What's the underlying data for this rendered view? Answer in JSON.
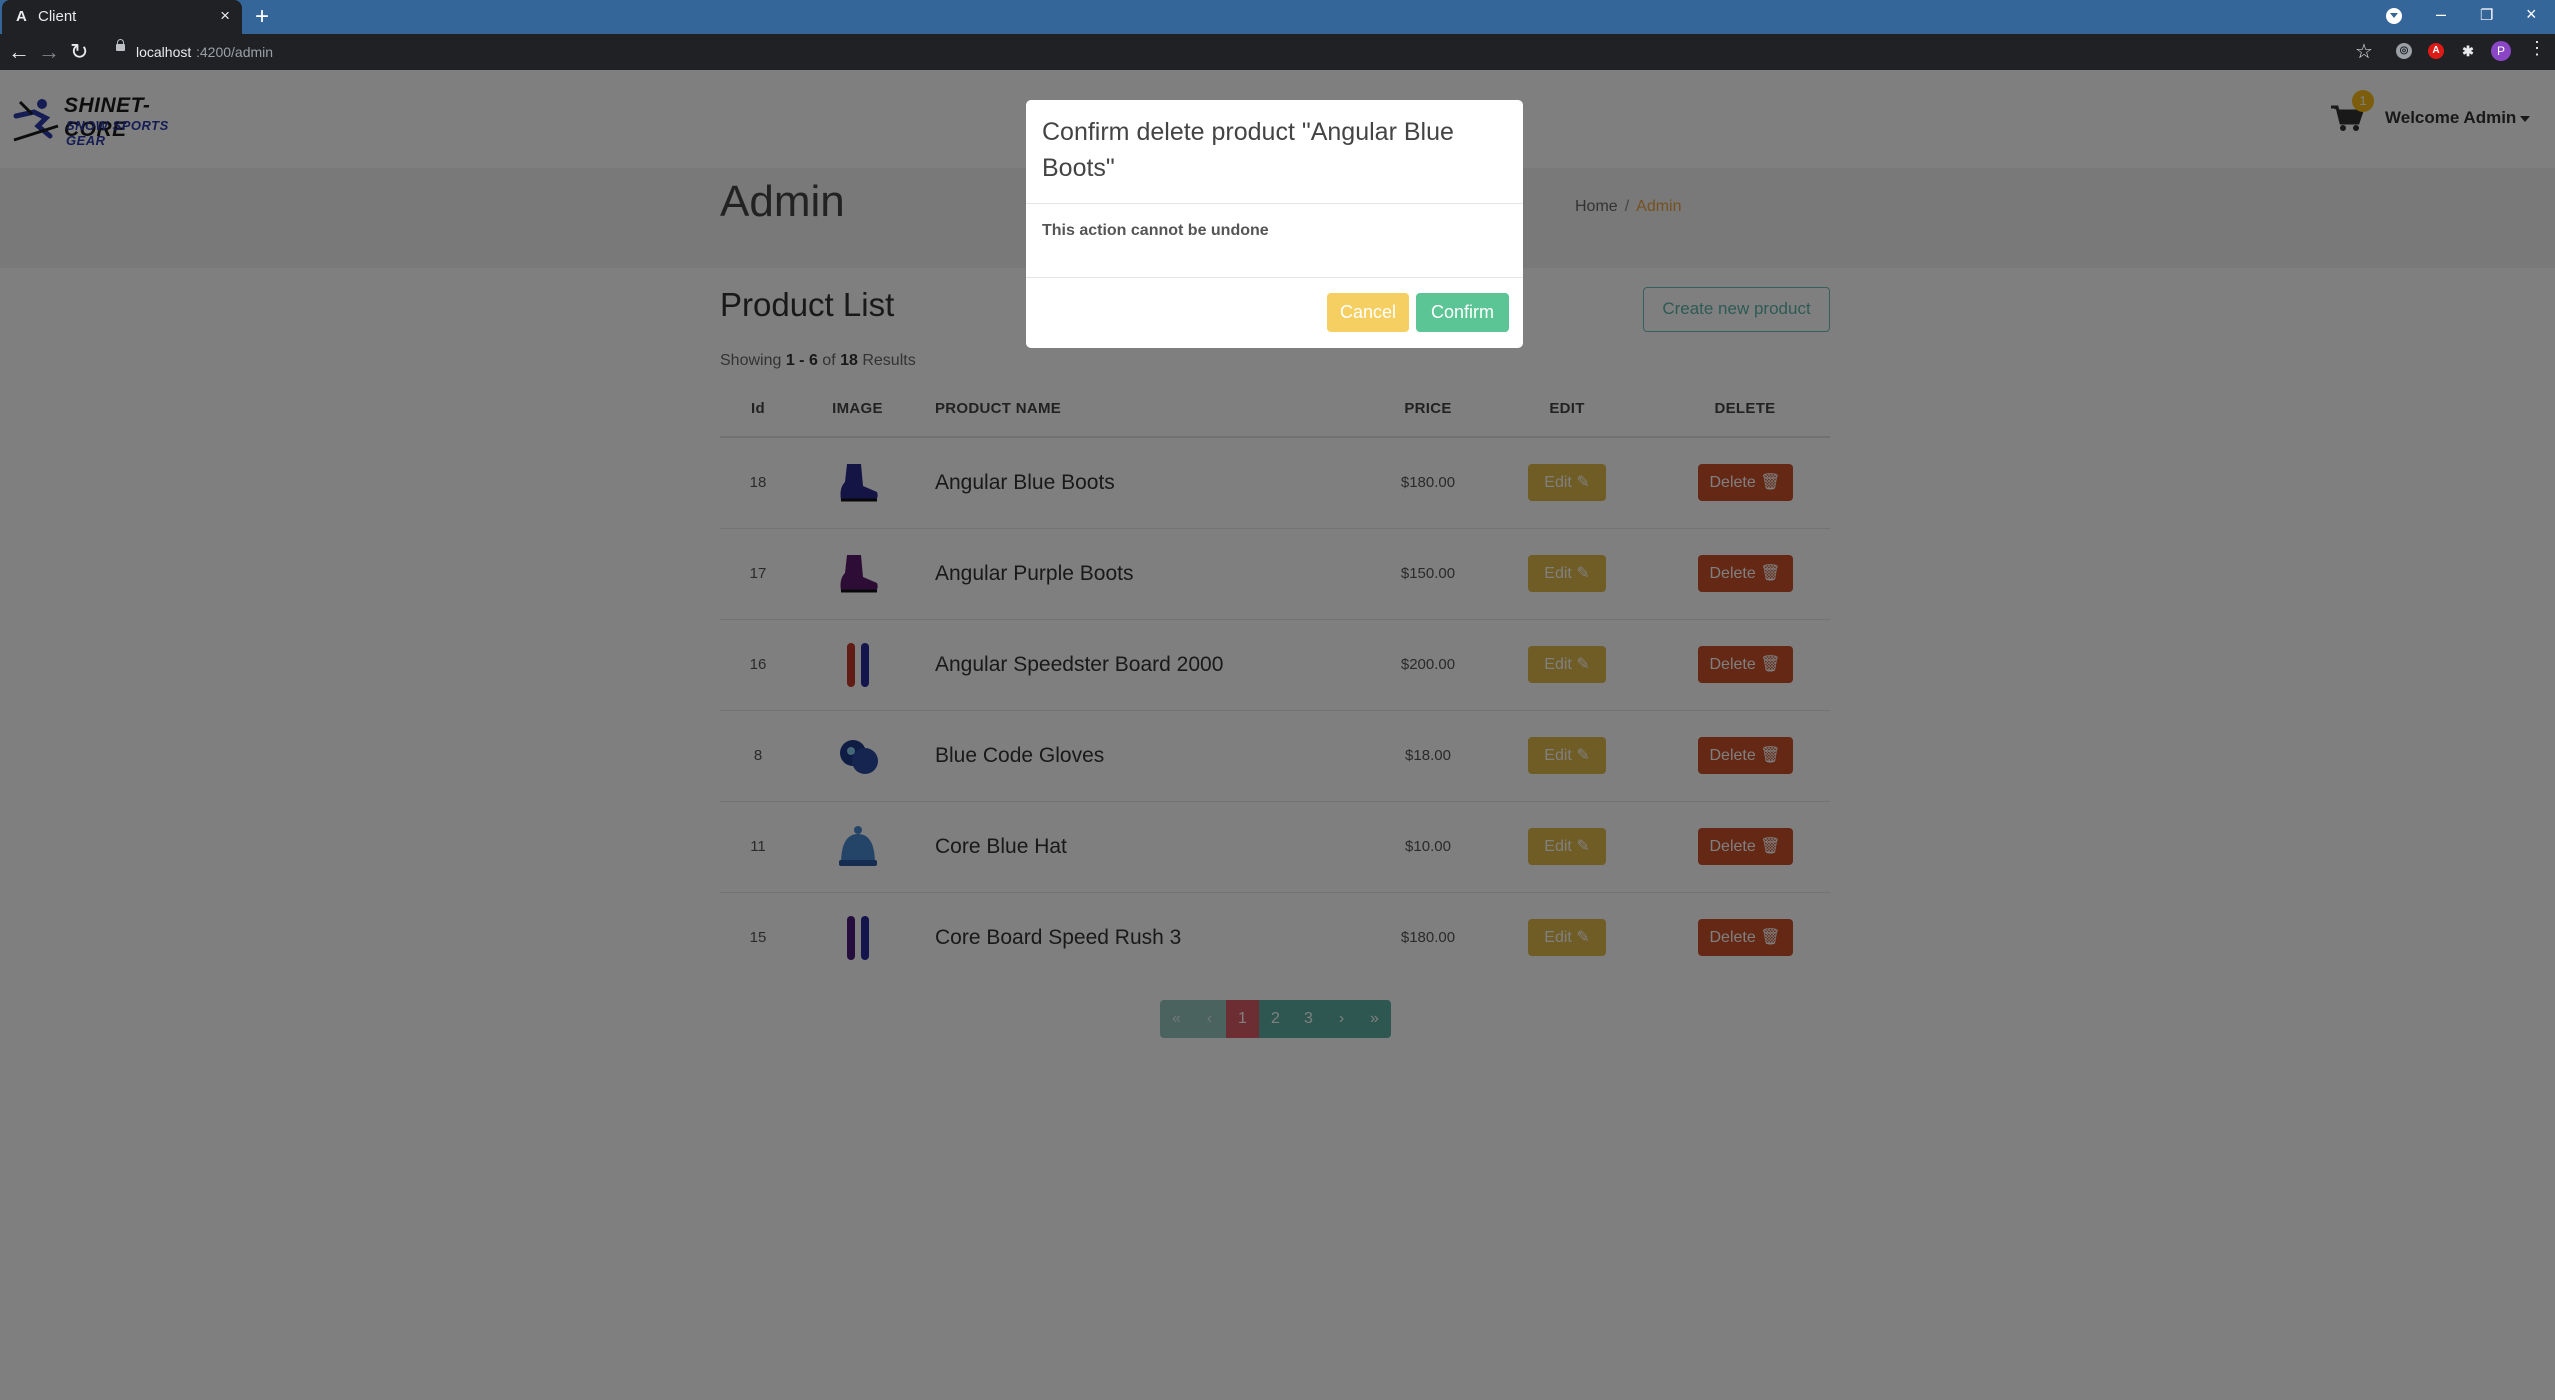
{
  "browser": {
    "tab_title": "Client",
    "tab_favicon": "A",
    "url_host": "localhost",
    "url_path": ":4200/admin",
    "profile_initial": "P"
  },
  "header": {
    "logo_line1": "SHINET-CORE",
    "logo_line2": "SNOW SPORTS GEAR",
    "cart_count": "1",
    "welcome": "Welcome Admin"
  },
  "hero": {
    "title": "Admin",
    "breadcrumb": {
      "home": "Home",
      "separator": "/",
      "current": "Admin"
    }
  },
  "product_list": {
    "title": "Product List",
    "create_button": "Create new product",
    "showing": {
      "prefix": "Showing",
      "range": "1 - 6",
      "of": "of",
      "total": "18",
      "suffix": "Results"
    },
    "columns": {
      "id": "Id",
      "image": "IMAGE",
      "name": "PRODUCT NAME",
      "price": "PRICE",
      "edit": "EDIT",
      "delete": "DELETE"
    },
    "edit_label": "Edit",
    "delete_label": "Delete",
    "rows": [
      {
        "id": "18",
        "name": "Angular Blue Boots",
        "price": "$180.00",
        "image": "boot-icon",
        "color": "#2a2a8a"
      },
      {
        "id": "17",
        "name": "Angular Purple Boots",
        "price": "$150.00",
        "image": "boot-icon",
        "color": "#5a1a6a"
      },
      {
        "id": "16",
        "name": "Angular Speedster Board 2000",
        "price": "$200.00",
        "image": "snowboard-icon",
        "color": "#c0392b"
      },
      {
        "id": "8",
        "name": "Blue Code Gloves",
        "price": "$18.00",
        "image": "gloves-icon",
        "color": "#1f3a8a"
      },
      {
        "id": "11",
        "name": "Core Blue Hat",
        "price": "$10.00",
        "image": "hat-icon",
        "color": "#4a8ad0"
      },
      {
        "id": "15",
        "name": "Core Board Speed Rush 3",
        "price": "$180.00",
        "image": "snowboard-icon",
        "color": "#4a1a7a"
      }
    ]
  },
  "pagination": {
    "first": "«",
    "prev": "‹",
    "pages": [
      "1",
      "2",
      "3"
    ],
    "current": "1",
    "next": "›",
    "last": "»"
  },
  "modal": {
    "title": "Confirm delete product \"Angular Blue Boots\"",
    "body": "This action cannot be undone",
    "cancel": "Cancel",
    "confirm": "Confirm"
  },
  "colors": {
    "edit": "#e0b84a",
    "delete": "#c8502a",
    "cancel": "#f6cf63",
    "confirm": "#5cc596",
    "accent": "#5aaea0",
    "breadcrumb_active": "#e8a33d"
  }
}
